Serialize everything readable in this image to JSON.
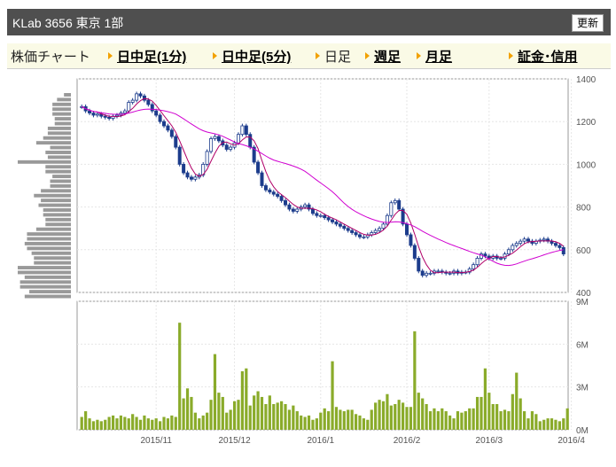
{
  "header": {
    "title": "KLab  3656  東京 1部",
    "refresh_label": "更新"
  },
  "tabs": {
    "label": "株価チャート",
    "items": [
      {
        "label": "日中足(1分)",
        "link": true
      },
      {
        "label": "日中足(5分)",
        "link": true
      },
      {
        "label": "日足",
        "link": false
      },
      {
        "label": "週足",
        "link": true
      },
      {
        "label": "月足",
        "link": true
      },
      {
        "label": "証金･信用",
        "link": true
      }
    ]
  },
  "chart_data": [
    {
      "type": "candlestick",
      "x_tick_labels": [
        "2015/11",
        "2015/12",
        "2016/1",
        "2016/2",
        "2016/3",
        "2016/4"
      ],
      "x_tick_index": [
        19,
        39,
        61,
        83,
        104,
        125
      ],
      "ylim": [
        400,
        1400
      ],
      "yticks": [
        "400",
        "600",
        "800",
        "1000",
        "1200",
        "1400"
      ],
      "colors": {
        "candle": "#1c3c8c",
        "ma_short": "#b00068",
        "ma_long": "#d000d0",
        "profile": "#999999"
      },
      "close": [
        1270,
        1250,
        1240,
        1230,
        1235,
        1225,
        1220,
        1215,
        1225,
        1230,
        1240,
        1250,
        1290,
        1300,
        1330,
        1320,
        1300,
        1280,
        1250,
        1230,
        1200,
        1180,
        1160,
        1130,
        1080,
        1000,
        960,
        940,
        930,
        940,
        950,
        1000,
        1060,
        1120,
        1130,
        1110,
        1090,
        1070,
        1080,
        1100,
        1140,
        1180,
        1140,
        1080,
        1010,
        960,
        900,
        880,
        870,
        860,
        850,
        830,
        810,
        790,
        780,
        790,
        800,
        810,
        790,
        770,
        760,
        760,
        750,
        740,
        730,
        720,
        710,
        700,
        690,
        680,
        670,
        660,
        660,
        670,
        680,
        690,
        700,
        720,
        760,
        820,
        830,
        790,
        720,
        670,
        620,
        560,
        500,
        480,
        490,
        490,
        500,
        500,
        495,
        490,
        490,
        500,
        490,
        495,
        495,
        510,
        530,
        560,
        580,
        570,
        560,
        570,
        560,
        560,
        580,
        600,
        620,
        630,
        640,
        650,
        640,
        630,
        640,
        645,
        650,
        640,
        630,
        620,
        610,
        580
      ],
      "volume_mm": [
        0.9,
        1.3,
        0.8,
        0.6,
        0.7,
        0.6,
        0.7,
        0.9,
        1.0,
        0.8,
        1.0,
        0.9,
        0.8,
        1.1,
        0.9,
        0.7,
        1.0,
        0.8,
        0.7,
        0.8,
        0.6,
        0.9,
        0.8,
        1.0,
        0.9,
        7.5,
        2.2,
        2.9,
        2.3,
        1.2,
        0.8,
        1.0,
        1.2,
        2.1,
        5.3,
        2.6,
        2.3,
        1.2,
        1.4,
        2.0,
        2.1,
        4.1,
        4.3,
        1.7,
        2.4,
        2.7,
        2.3,
        1.8,
        2.4,
        1.8,
        1.9,
        2.0,
        1.8,
        1.4,
        1.7,
        1.3,
        1.0,
        0.9,
        1.0,
        0.7,
        0.8,
        1.2,
        1.5,
        1.3,
        4.8,
        1.6,
        1.4,
        1.3,
        1.4,
        1.4,
        1.1,
        1.0,
        0.8,
        0.7,
        1.4,
        1.9,
        2.1,
        2.0,
        2.5,
        1.7,
        1.8,
        2.1,
        1.9,
        1.6,
        1.6,
        6.9,
        2.6,
        2.2,
        1.8,
        1.3,
        1.5,
        1.3,
        1.5,
        1.3,
        1.0,
        0.8,
        1.3,
        1.2,
        1.3,
        1.5,
        1.5,
        2.3,
        2.3,
        4.3,
        2.6,
        1.8,
        1.8,
        1.3,
        1.4,
        1.3,
        2.5,
        4.0,
        2.2,
        1.3,
        0.8,
        1.3,
        1.1,
        0.6,
        0.7,
        0.8,
        0.8,
        0.7,
        0.6,
        0.8,
        1.5
      ],
      "volume_yticks": [
        "0M",
        "3M",
        "6M",
        "9M"
      ],
      "volume_ylim": [
        0,
        9
      ],
      "price_profile_relative": [
        0.03,
        0.06,
        0.08,
        0.08,
        0.08,
        0.07,
        0.07,
        0.1,
        0.1,
        0.12,
        0.15,
        0.09,
        0.11,
        0.1,
        0.23,
        0.11,
        0.11,
        0.08,
        0.09,
        0.09,
        0.13,
        0.16,
        0.13,
        0.14,
        0.12,
        0.12,
        0.11,
        0.11,
        0.15,
        0.19,
        0.19,
        0.2,
        0.19,
        0.17,
        0.16,
        0.16,
        0.23,
        0.23,
        0.2,
        0.22,
        0.22,
        0.18,
        0.2
      ]
    }
  ]
}
